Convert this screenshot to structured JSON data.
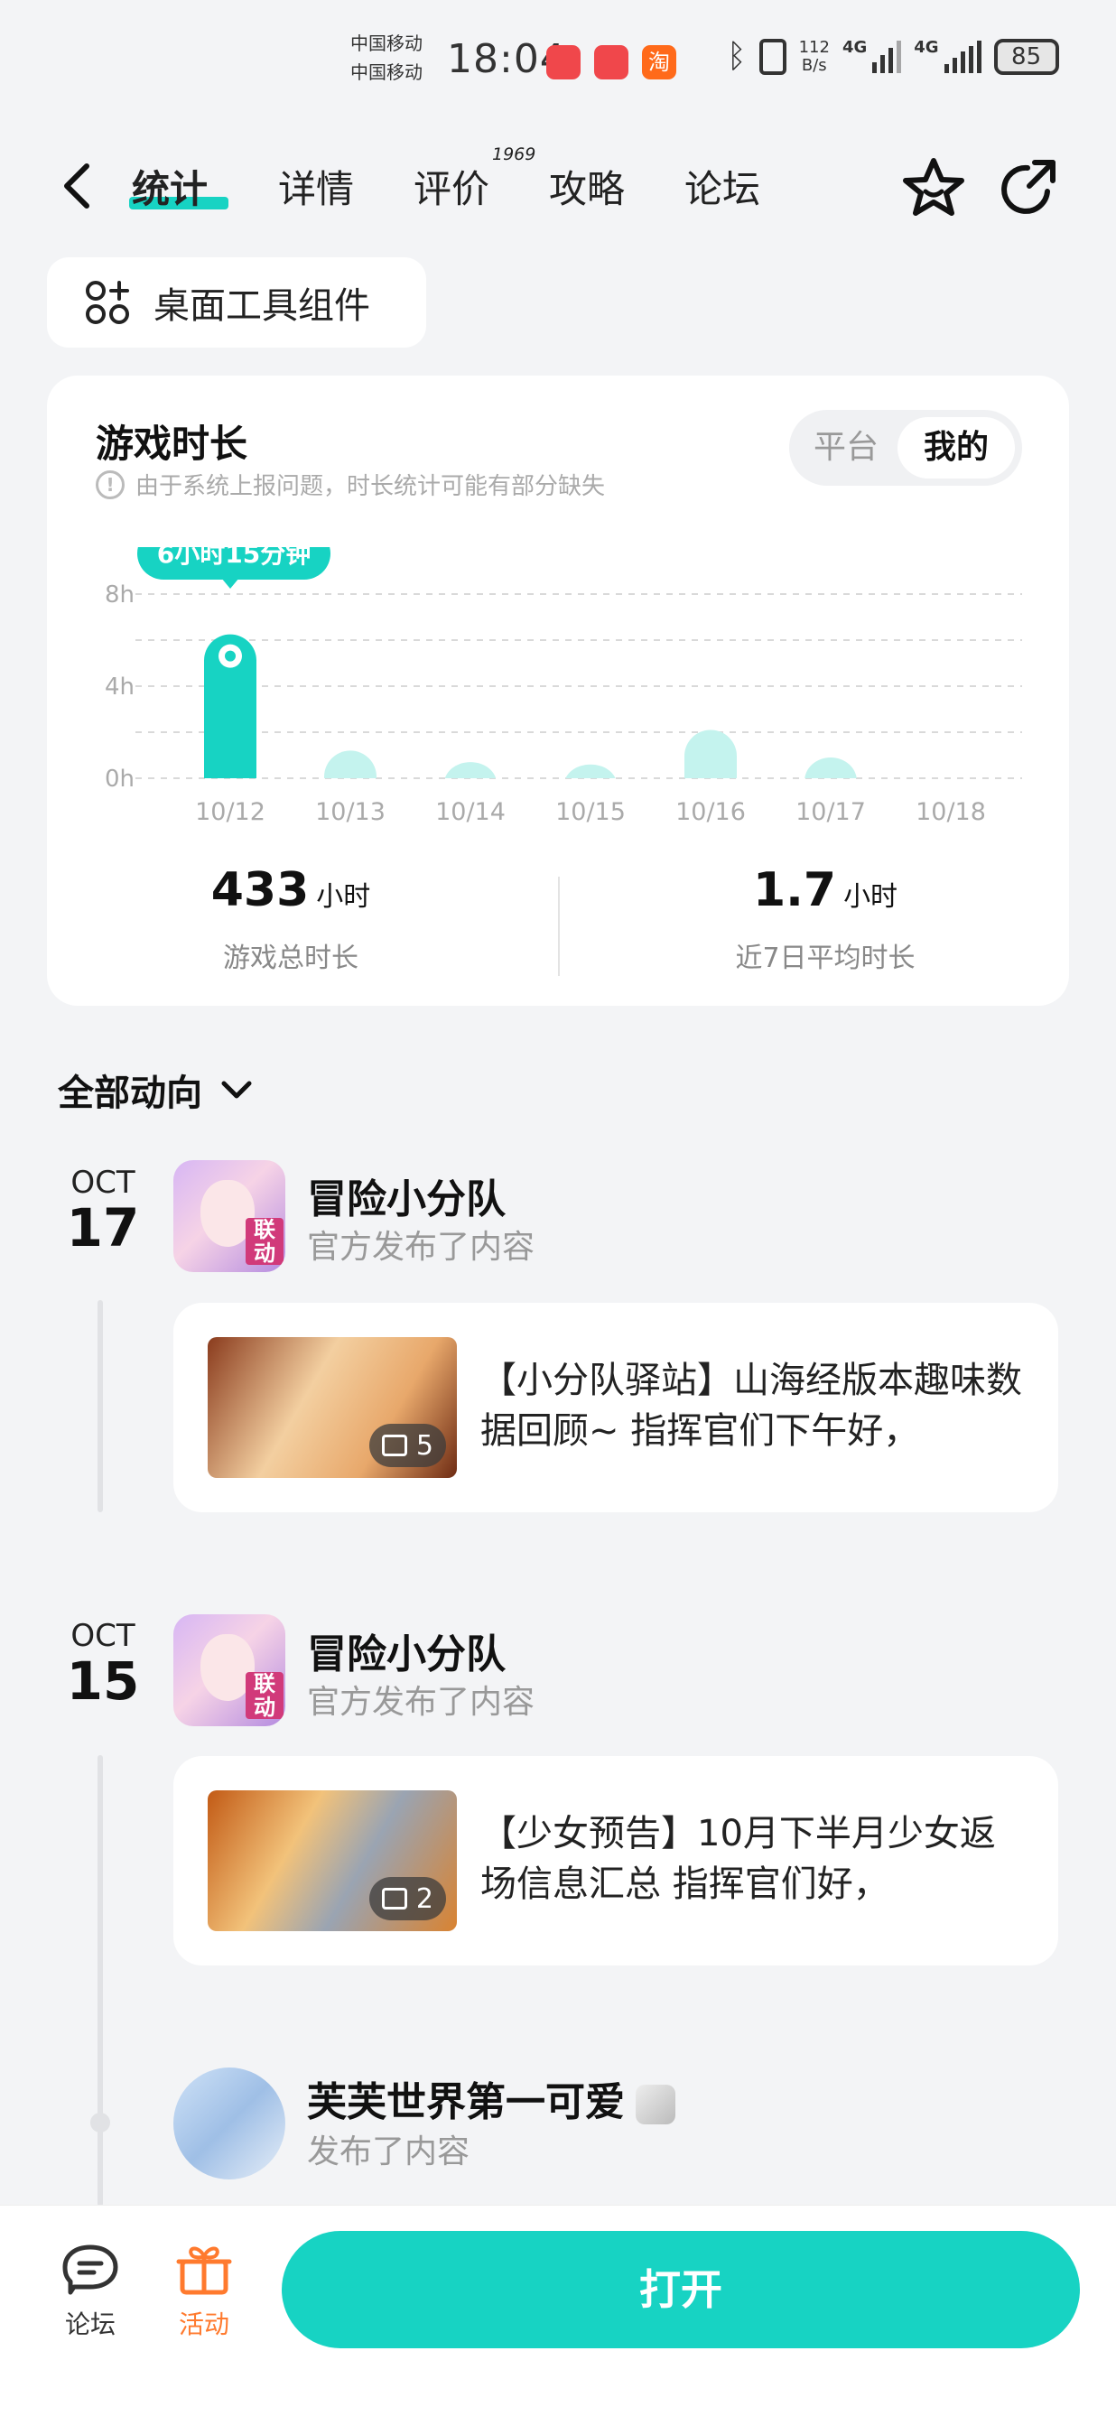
{
  "status_bar": {
    "carrier_1": "中国移动",
    "carrier_2": "中国移动",
    "time": "18:04",
    "taobao_label": "淘",
    "net_speed_value": "112",
    "net_speed_unit": "B/s",
    "signal_1_label": "4G",
    "signal_2_label": "4G",
    "battery": "85"
  },
  "nav": {
    "tabs": [
      {
        "label": "统计"
      },
      {
        "label": "详情"
      },
      {
        "label": "评价"
      },
      {
        "label": "攻略"
      },
      {
        "label": "论坛"
      }
    ],
    "review_count": "1969"
  },
  "widget_button": {
    "label": "桌面工具组件"
  },
  "stats": {
    "title": "游戏时长",
    "note": "由于系统上报问题，时长统计可能有部分缺失",
    "segment": {
      "platform": "平台",
      "mine": "我的",
      "selected": "我的"
    },
    "tooltip": "6小时15分钟",
    "total": {
      "value": "433",
      "unit": "小时",
      "caption": "游戏总时长"
    },
    "average": {
      "value": "1.7",
      "unit": "小时",
      "caption": "近7日平均时长"
    }
  },
  "chart_data": {
    "type": "bar",
    "categories": [
      "10/12",
      "10/13",
      "10/14",
      "10/15",
      "10/16",
      "10/17",
      "10/18"
    ],
    "values": [
      6.25,
      1.2,
      0.7,
      0.6,
      2.1,
      0.9,
      0
    ],
    "yticks": [
      "8h",
      "4h",
      "0h"
    ],
    "ylim": [
      0,
      8
    ],
    "highlighted_index": 0,
    "grid": true,
    "colors": {
      "highlight": "#17d3c3",
      "normal": "#c4f3ee"
    }
  },
  "feed": {
    "filter_label": "全部动向",
    "entries": [
      {
        "month": "OCT",
        "day": "17",
        "author": "冒险小分队",
        "action": "官方发布了内容",
        "avatar_tag": "联动",
        "post_text": "【小分队驿站】山海经版本趣味数据回顾~ 指挥官们下午好，",
        "image_count": "5"
      },
      {
        "month": "OCT",
        "day": "15",
        "author": "冒险小分队",
        "action": "官方发布了内容",
        "avatar_tag": "联动",
        "post_text": "【少女预告】10月下半月少女返场信息汇总 指挥官们好，",
        "image_count": "2"
      },
      {
        "author": "芙芙世界第一可爱",
        "action": "发布了内容"
      }
    ]
  },
  "bottom_bar": {
    "forum_label": "论坛",
    "event_label": "活动",
    "open_label": "打开"
  },
  "colors": {
    "accent": "#17d3c3",
    "event": "#ff7a2e"
  }
}
